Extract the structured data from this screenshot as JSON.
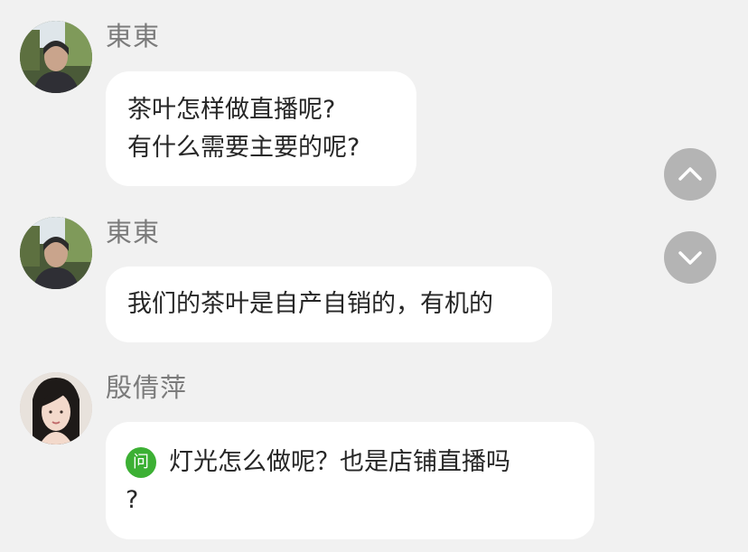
{
  "messages": [
    {
      "sender": "東東",
      "lines": [
        "茶叶怎样做直播呢?",
        "有什么需要主要的呢?"
      ]
    },
    {
      "sender": "東東",
      "lines": [
        "我们的茶叶是自产自销的，有机的"
      ]
    },
    {
      "sender": "殷倩萍",
      "badge": "问",
      "lines": [
        "灯光怎么做呢？也是店铺直播吗",
        "?"
      ]
    }
  ],
  "nav": {
    "up_icon": "chevron-up-icon",
    "down_icon": "chevron-down-icon"
  },
  "colors": {
    "background": "#f1f1f1",
    "bubble": "#ffffff",
    "badge": "#3cb034",
    "nav_button": "#b4b4b4",
    "sender_text": "#7b7b7b"
  }
}
